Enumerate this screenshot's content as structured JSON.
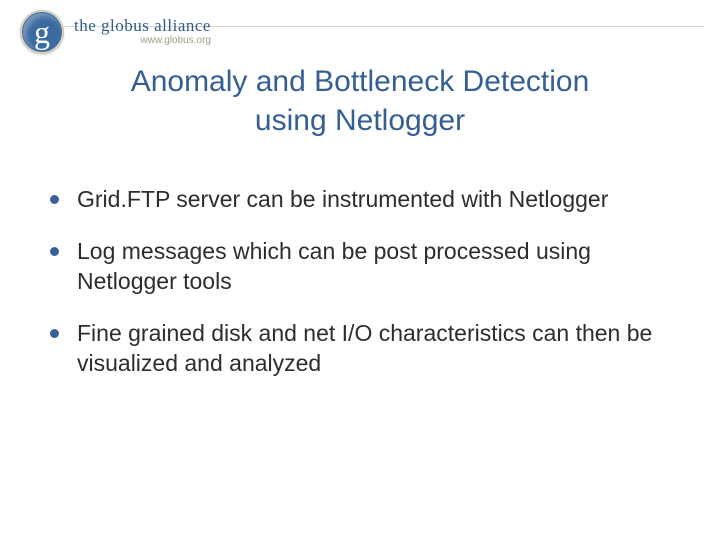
{
  "logo": {
    "glyph": "g",
    "line1": "the globus alliance",
    "line2": "www.globus.org"
  },
  "title_line1": "Anomaly and Bottleneck Detection",
  "title_line2": "using Netlogger",
  "bullets": [
    "Grid.FTP server can be instrumented with Netlogger",
    "Log messages which can be post processed using Netlogger tools",
    "Fine grained disk and net I/O characteristics can then be visualized and analyzed"
  ]
}
